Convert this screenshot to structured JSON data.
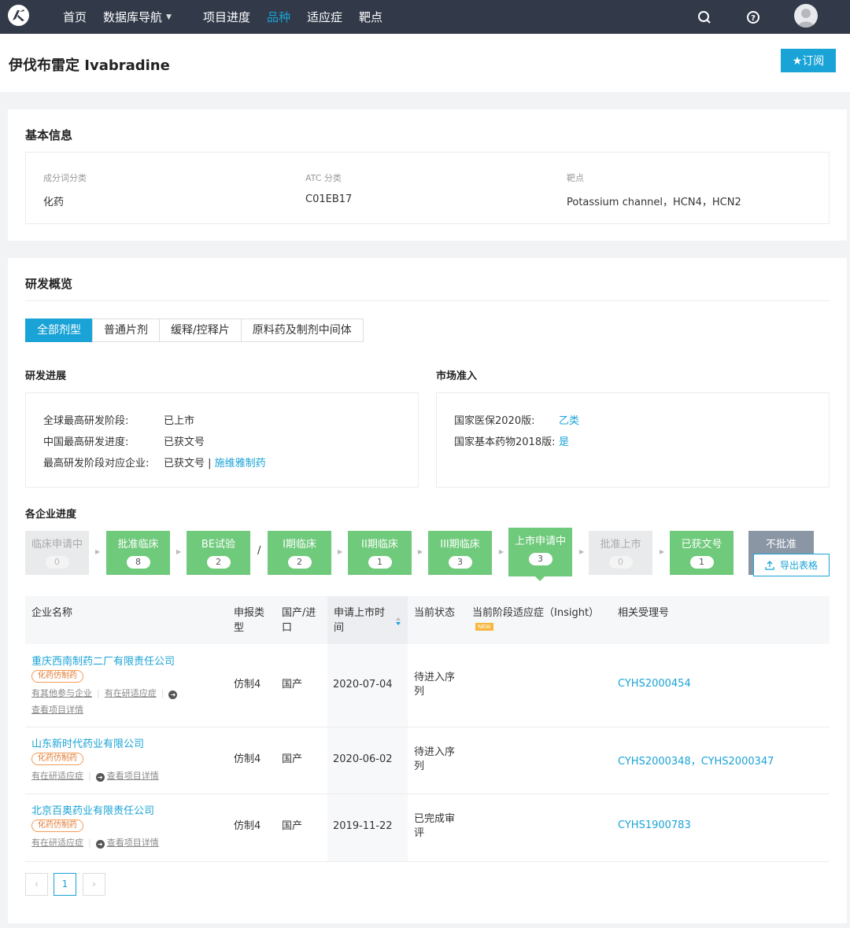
{
  "nav": {
    "items": [
      "首页",
      "数据库导航",
      "项目进度",
      "品种",
      "适应症",
      "靶点"
    ],
    "active": "品种"
  },
  "header": {
    "title": "伊伐布雷定 Ivabradine",
    "subscribe_label": "★订阅"
  },
  "basic": {
    "title": "基本信息",
    "fields": [
      {
        "label": "成分词分类",
        "value": "化药"
      },
      {
        "label": "ATC 分类",
        "value": "C01EB17"
      },
      {
        "label": "靶点",
        "value": "Potassium channel，HCN4，HCN2"
      }
    ]
  },
  "rd": {
    "title": "研发概览",
    "tabs": [
      "全部剂型",
      "普通片剂",
      "缓释/控释片",
      "原料药及制剂中间体"
    ],
    "progress": {
      "title": "研发进展",
      "rows": [
        {
          "key": "全球最高研发阶段:",
          "value": "已上市"
        },
        {
          "key": "中国最高研发进度:",
          "value": "已获文号"
        },
        {
          "key": "最高研发阶段对应企业:",
          "value": "已获文号 |",
          "link": "施维雅制药"
        }
      ]
    },
    "market": {
      "title": "市场准入",
      "rows": [
        {
          "key": "国家医保2020版:",
          "value": "乙类"
        },
        {
          "key": "国家基本药物2018版:",
          "value": "是"
        }
      ]
    },
    "company_progress_title": "各企业进度",
    "stages": [
      {
        "label": "临床申请中",
        "count": "0",
        "style": "grey"
      },
      {
        "label": "批准临床",
        "count": "8",
        "style": "green"
      },
      {
        "label": "BE试验",
        "count": "2",
        "style": "green"
      },
      {
        "label": "I期临床",
        "count": "2",
        "style": "green"
      },
      {
        "label": "II期临床",
        "count": "1",
        "style": "green"
      },
      {
        "label": "III期临床",
        "count": "3",
        "style": "green"
      },
      {
        "label": "上市申请中",
        "count": "3",
        "style": "green"
      },
      {
        "label": "批准上市",
        "count": "0",
        "style": "grey"
      },
      {
        "label": "已获文号",
        "count": "1",
        "style": "green"
      },
      {
        "label": "不批准",
        "count": "",
        "style": "dark"
      }
    ],
    "slash": "/",
    "export_label": "导出表格"
  },
  "table": {
    "headers": {
      "company": "企业名称",
      "type": "申报类型",
      "origin": "国产/进口",
      "date": "申请上市时间",
      "status": "当前状态",
      "indication": "当前阶段适应症（Insight）",
      "regno": "相关受理号",
      "new_badge": "NEW"
    },
    "rows": [
      {
        "company": "重庆西南制药二厂有限责任公司",
        "tag": "化药仿制药",
        "ops": [
          "有其他参与企业",
          "有在研适应症",
          "查看项目详情"
        ],
        "type": "仿制4",
        "origin": "国产",
        "date": "2020-07-04",
        "status": "待进入序列",
        "regno": "CYHS2000454"
      },
      {
        "company": "山东新时代药业有限公司",
        "tag": "化药仿制药",
        "ops": [
          "有在研适应症",
          "查看项目详情"
        ],
        "type": "仿制4",
        "origin": "国产",
        "date": "2020-06-02",
        "status": "待进入序列",
        "regno": "CYHS2000348，CYHS2000347"
      },
      {
        "company": "北京百奥药业有限责任公司",
        "tag": "化药仿制药",
        "ops": [
          "有在研适应症",
          "查看项目详情"
        ],
        "type": "仿制4",
        "origin": "国产",
        "date": "2019-11-22",
        "status": "已完成审评",
        "regno": "CYHS1900783"
      }
    ]
  },
  "pagination": {
    "prev": "‹",
    "current": "1",
    "next": "›"
  },
  "colors": {
    "accent": "#1aa3d6",
    "nav_bg": "#323a4a",
    "stage_green": "#6fca7b",
    "tag_orange": "#f39b55"
  }
}
